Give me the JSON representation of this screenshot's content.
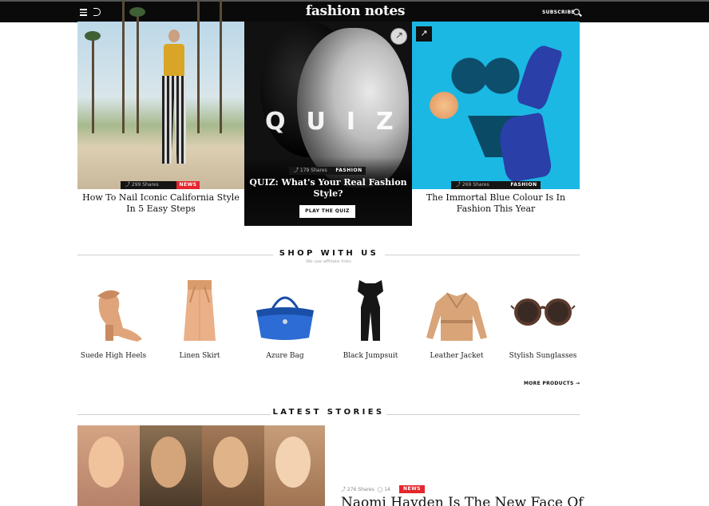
{
  "header": {
    "logo": "fashion notes",
    "subscribe_label": "SUBSCRIBE",
    "menu_icon": "hamburger-menu-icon",
    "theme_icon": "dark-mode-moon-icon",
    "search_icon": "search-icon"
  },
  "hero": [
    {
      "shares": "299 Shares",
      "tag": "NEWS",
      "title_line1": "How To Nail Iconic California Style",
      "title_line2": "In 5 Easy Steps"
    },
    {
      "overlay_text": "QUIZ",
      "shares": "179 Shares",
      "tag": "FASHION",
      "title_line1": "QUIZ: What's Your Real Fashion",
      "title_line2": "Style?",
      "button_label": "PLAY THE QUIZ"
    },
    {
      "shares": "269 Shares",
      "tag": "FASHION",
      "title_line1": "The Immortal Blue Colour Is In",
      "title_line2": "Fashion This Year"
    }
  ],
  "shop": {
    "heading": "SHOP WITH US",
    "affiliate_note": "We use affiliate links",
    "products": [
      {
        "name": "Suede High Heels"
      },
      {
        "name": "Linen Skirt"
      },
      {
        "name": "Azure Bag"
      },
      {
        "name": "Black Jumpsuit"
      },
      {
        "name": "Leather Jacket"
      },
      {
        "name": "Stylish Sunglasses"
      }
    ],
    "more_label": "MORE PRODUCTS",
    "more_arrow": "→"
  },
  "latest": {
    "heading": "LATEST STORIES",
    "story": {
      "shares": "276 Shares",
      "comments": "14",
      "tag": "NEWS",
      "title": "Naomi Hayden Is The New Face Of"
    }
  },
  "colors": {
    "accent_red": "#e5262d",
    "header_bg": "#0a0a0a",
    "blue_bg": "#1bb8e3"
  }
}
